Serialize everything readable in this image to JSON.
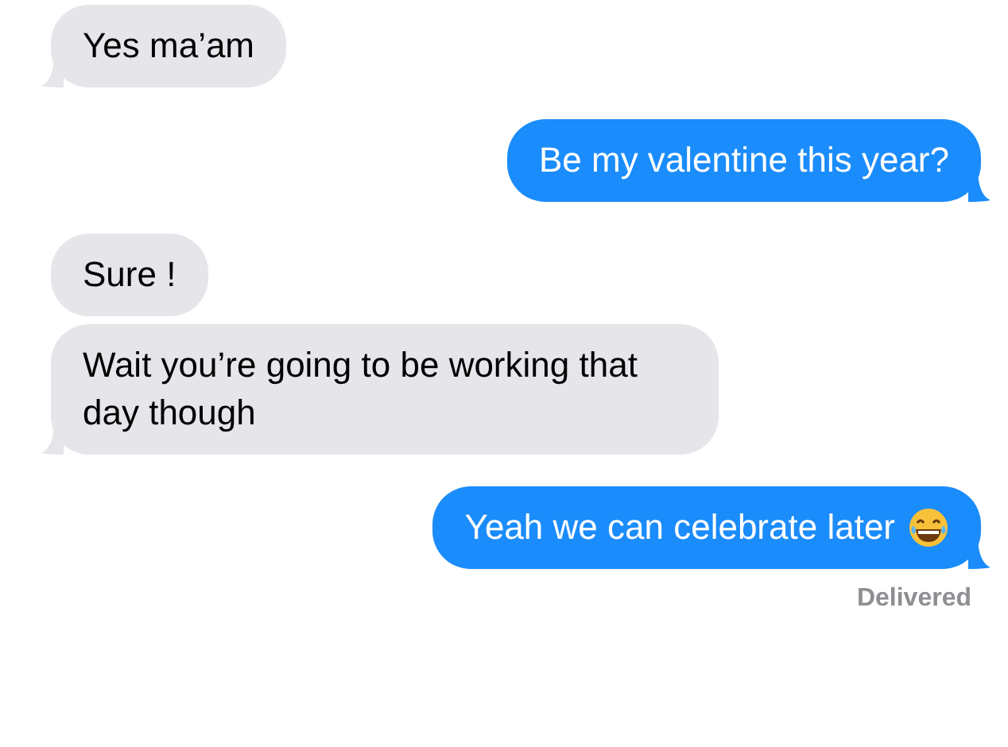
{
  "messages": [
    {
      "kind": "received",
      "text": "Yes ma’am",
      "tail": true
    },
    {
      "kind": "sent",
      "text": "Be my valentine this year?",
      "tail": true
    },
    {
      "kind": "received",
      "text": "Sure !",
      "tail": false
    },
    {
      "kind": "received",
      "text": "Wait you’re going to be working that day though",
      "tail": true
    },
    {
      "kind": "sent",
      "text": "Yeah we can celebrate later",
      "tail": true,
      "trailing_emoji": true
    }
  ],
  "status": "Delivered"
}
